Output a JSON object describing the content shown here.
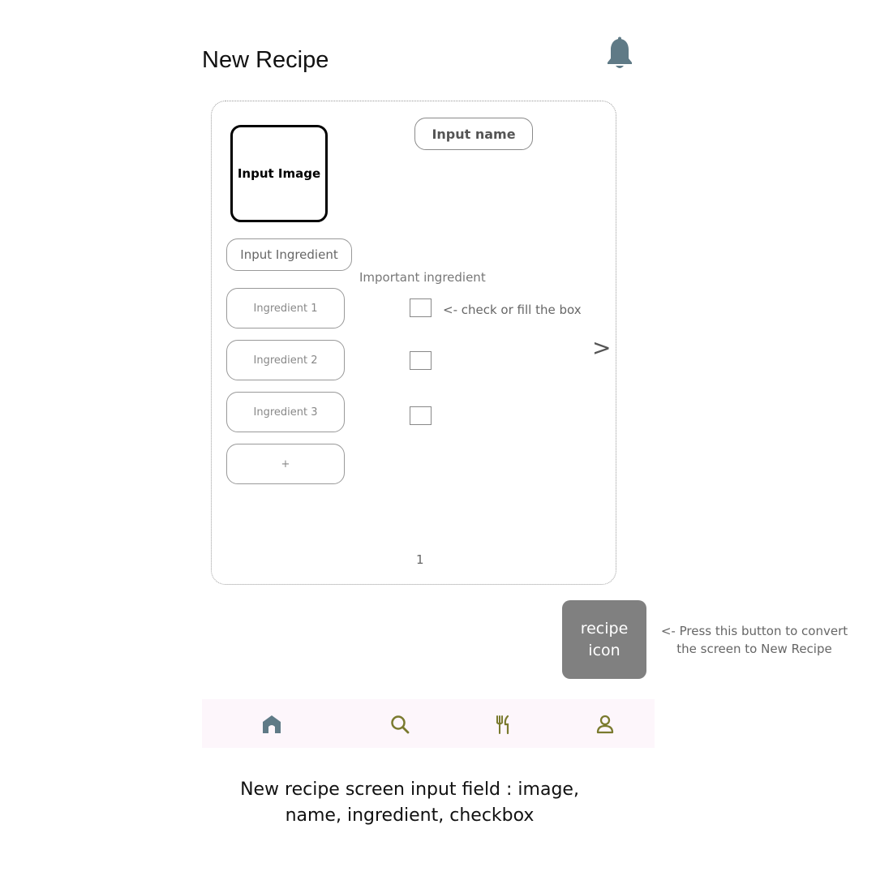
{
  "header": {
    "title": "New Recipe",
    "notification_icon": "bell-icon",
    "bell_color": "#5f7a86"
  },
  "form": {
    "image_label": "Input Image",
    "name_label": "Input name",
    "ingredient_label": "Input Ingredient",
    "important_label": "Important ingredient",
    "check_hint": "<- check or fill the box",
    "ingredients": [
      "Ingredient 1",
      "Ingredient 2",
      "Ingredient 3"
    ],
    "add_label": "+",
    "next_label": ">",
    "page_number": "1"
  },
  "recipe_button": {
    "label": "recipe icon",
    "hint": "<- Press this button to convert the screen to New Recipe",
    "color": "#808080"
  },
  "bottom_nav": {
    "items": [
      "home-icon",
      "search-icon",
      "utensils-icon",
      "profile-icon"
    ],
    "active_color": "#5f7a86",
    "icon_color": "#7a7a2e",
    "background": "#fdf6fb"
  },
  "caption": "New recipe screen input field : image, name, ingredient, checkbox"
}
